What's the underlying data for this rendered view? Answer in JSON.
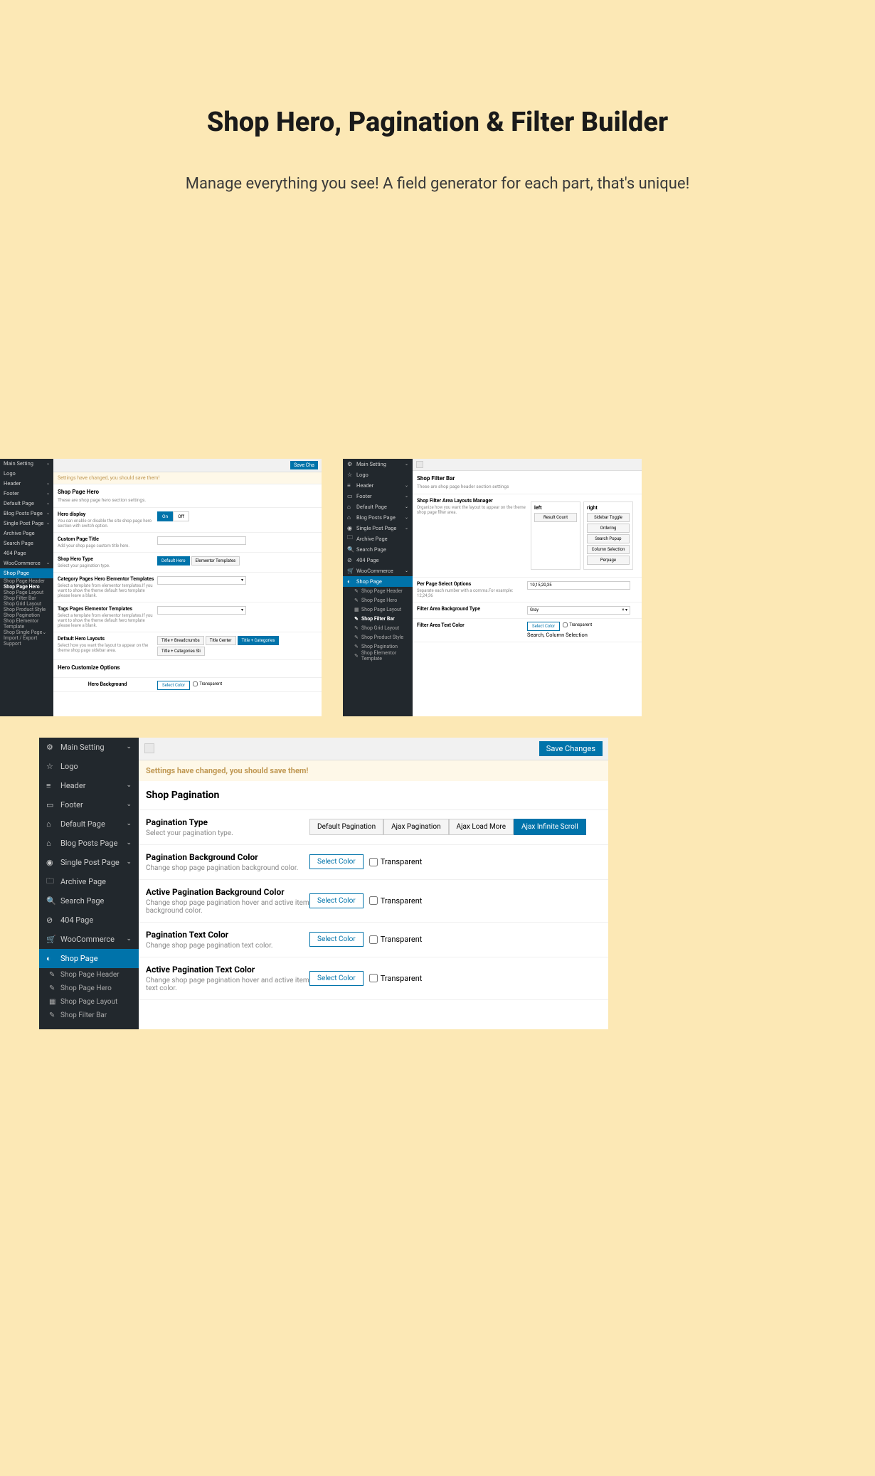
{
  "hero": {
    "title": "Shop Hero, Pagination & Filter Builder",
    "subtitle": "Manage everything you see! A field generator for each part, that's unique!"
  },
  "save_btn": "Save Changes",
  "save_btn_short": "Save Cha",
  "notice": "Settings have changed, you should save them!",
  "sidebar": {
    "items": [
      {
        "icon": "⚙",
        "label": "Main Setting",
        "chev": true
      },
      {
        "icon": "☆",
        "label": "Logo"
      },
      {
        "icon": "≡",
        "label": "Header",
        "chev": true
      },
      {
        "icon": "▭",
        "label": "Footer",
        "chev": true
      },
      {
        "icon": "⌂",
        "label": "Default Page",
        "chev": true
      },
      {
        "icon": "⌂",
        "label": "Blog Posts Page",
        "chev": true
      },
      {
        "icon": "◉",
        "label": "Single Post Page",
        "chev": true
      },
      {
        "icon": "🗀",
        "label": "Archive Page"
      },
      {
        "icon": "🔍",
        "label": "Search Page"
      },
      {
        "icon": "⊘",
        "label": "404 Page"
      },
      {
        "icon": "🛒",
        "label": "WooCommerce",
        "chev": true
      },
      {
        "icon": "◐",
        "label": "Shop Page",
        "active": true
      }
    ],
    "subs": [
      {
        "icon": "✎",
        "label": "Shop Page Header"
      },
      {
        "icon": "✎",
        "label": "Shop Page Hero"
      },
      {
        "icon": "▦",
        "label": "Shop Page Layout"
      },
      {
        "icon": "✎",
        "label": "Shop Filter Bar"
      },
      {
        "icon": "✎",
        "label": "Shop Grid Layout"
      },
      {
        "icon": "✎",
        "label": "Shop Product Style"
      },
      {
        "icon": "✎",
        "label": "Shop Pagination"
      },
      {
        "icon": "✎",
        "label": "Shop Elementor Template"
      },
      {
        "icon": "",
        "label": "Shop Single Page",
        "chev": true
      },
      {
        "icon": "",
        "label": "Import / Export"
      },
      {
        "icon": "",
        "label": "Support"
      }
    ]
  },
  "panel1": {
    "section_title": "Shop Page Hero",
    "section_desc": "These are shop page hero section settings.",
    "fields": {
      "hero_display": {
        "title": "Hero display",
        "desc": "You can enable or disable the site shop page hero section with switch option.",
        "on": "On",
        "off": "Off"
      },
      "custom_title": {
        "title": "Custom Page Title",
        "desc": "Add your shop page custom title here."
      },
      "hero_type": {
        "title": "Shop Hero Type",
        "desc": "Select your pagination type.",
        "opts": [
          "Default Hero",
          "Elementor Templates"
        ]
      },
      "cat_templates": {
        "title": "Category Pages Hero Elementor Templates",
        "desc": "Select a template from elementor templates.If you want to show the theme default hero template please leave a blank."
      },
      "tag_templates": {
        "title": "Tags Pages Elementor Templates",
        "desc": "Select a template from elementor templates.If you want to show the theme default hero template please leave a blank."
      },
      "hero_layouts": {
        "title": "Default Hero Layouts",
        "desc": "Select how you want the layout to appear on the theme shop page sidebar area.",
        "opts": [
          "Title + Breadcrumbs",
          "Title Center",
          "Title + Categories",
          "Title + Categories Sli"
        ]
      },
      "customize": {
        "title": "Hero Customize Options"
      },
      "hero_bg": {
        "title": "Hero Background",
        "select": "Select Color",
        "transparent": "Transparent"
      }
    },
    "sub_bold": "Shop Page Hero"
  },
  "panel2": {
    "section_title": "Shop Filter Bar",
    "section_desc": "These are shop page header section settings",
    "layouts": {
      "title": "Shop Filter Area Layouts Manager",
      "desc": "Organize how you want the layout to appear on the theme shop page filter area.",
      "left": {
        "hdr": "left",
        "btns": [
          "Result Count"
        ]
      },
      "right": {
        "hdr": "right",
        "btns": [
          "Sidebar Toggle",
          "Ordering",
          "Search Popup",
          "Column Selection",
          "Perpage"
        ]
      }
    },
    "fields": {
      "perpage": {
        "title": "Per Page Select Options",
        "desc": "Separate each number with a comma.For example: 12,24,36",
        "value": "10,15,20,35"
      },
      "bgtype": {
        "title": "Filter Area Background Type",
        "value": "Gray"
      },
      "textcolor": {
        "title": "Filter Area Text Color",
        "select": "Select Color",
        "transparent": "Transparent",
        "extra": "Search, Column Selection"
      }
    },
    "sub_bold": "Shop Filter Bar"
  },
  "panel3": {
    "section_title": "Shop Pagination",
    "fields": {
      "type": {
        "title": "Pagination Type",
        "desc": "Select your pagination type.",
        "opts": [
          "Default Pagination",
          "Ajax Pagination",
          "Ajax Load More",
          "Ajax Infinite Scroll"
        ]
      },
      "bg": {
        "title": "Pagination Background Color",
        "desc": "Change shop page pagination background color.",
        "select": "Select Color",
        "transparent": "Transparent"
      },
      "abg": {
        "title": "Active Pagination Background Color",
        "desc": "Change shop page pagination hover and active item background color.",
        "select": "Select Color",
        "transparent": "Transparent"
      },
      "txt": {
        "title": "Pagination Text Color",
        "desc": "Change shop page pagination text color.",
        "select": "Select Color",
        "transparent": "Transparent"
      },
      "atxt": {
        "title": "Active Pagination Text Color",
        "desc": "Change shop page pagination hover and active item text color.",
        "select": "Select Color",
        "transparent": "Transparent"
      }
    }
  }
}
